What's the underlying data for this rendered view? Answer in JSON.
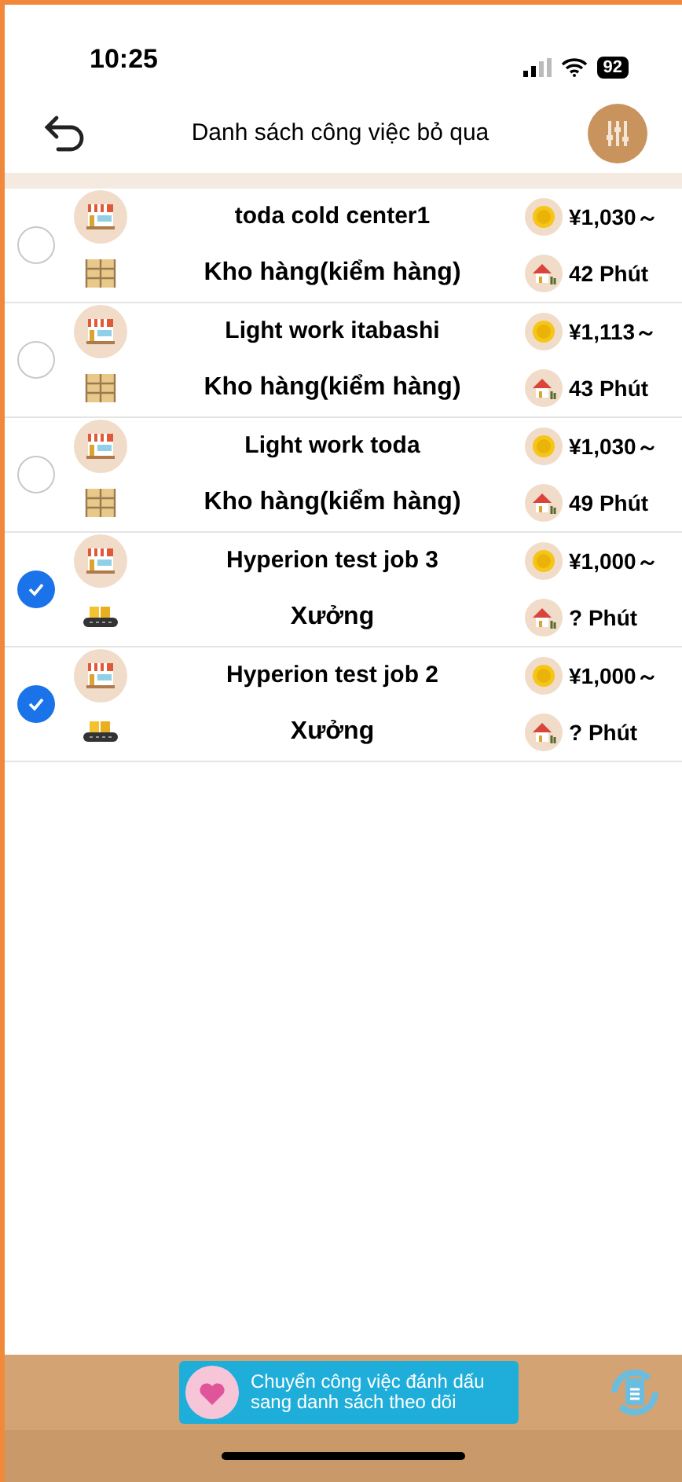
{
  "status_bar": {
    "time": "10:25",
    "battery": "92"
  },
  "header": {
    "title": "Danh sách công việc bỏ qua"
  },
  "jobs": [
    {
      "selected": false,
      "kind": "warehouse",
      "name": "toda cold center1",
      "category": "Kho hàng(kiểm hàng)",
      "wage": "¥1,030～",
      "commute": "42 Phút"
    },
    {
      "selected": false,
      "kind": "warehouse",
      "name": "Light work itabashi",
      "category": "Kho hàng(kiểm hàng)",
      "wage": "¥1,113～",
      "commute": "43 Phút"
    },
    {
      "selected": false,
      "kind": "warehouse",
      "name": "Light work toda",
      "category": "Kho hàng(kiểm hàng)",
      "wage": "¥1,030～",
      "commute": "49 Phút"
    },
    {
      "selected": true,
      "kind": "factory",
      "name": "Hyperion test job 3",
      "category": "Xưởng",
      "wage": "¥1,000～",
      "commute": "? Phút"
    },
    {
      "selected": true,
      "kind": "factory",
      "name": "Hyperion test job 2",
      "category": "Xưởng",
      "wage": "¥1,000～",
      "commute": "? Phút"
    }
  ],
  "footer": {
    "move_button": "Chuyển công việc đánh dấu sang danh sách theo dõi"
  }
}
